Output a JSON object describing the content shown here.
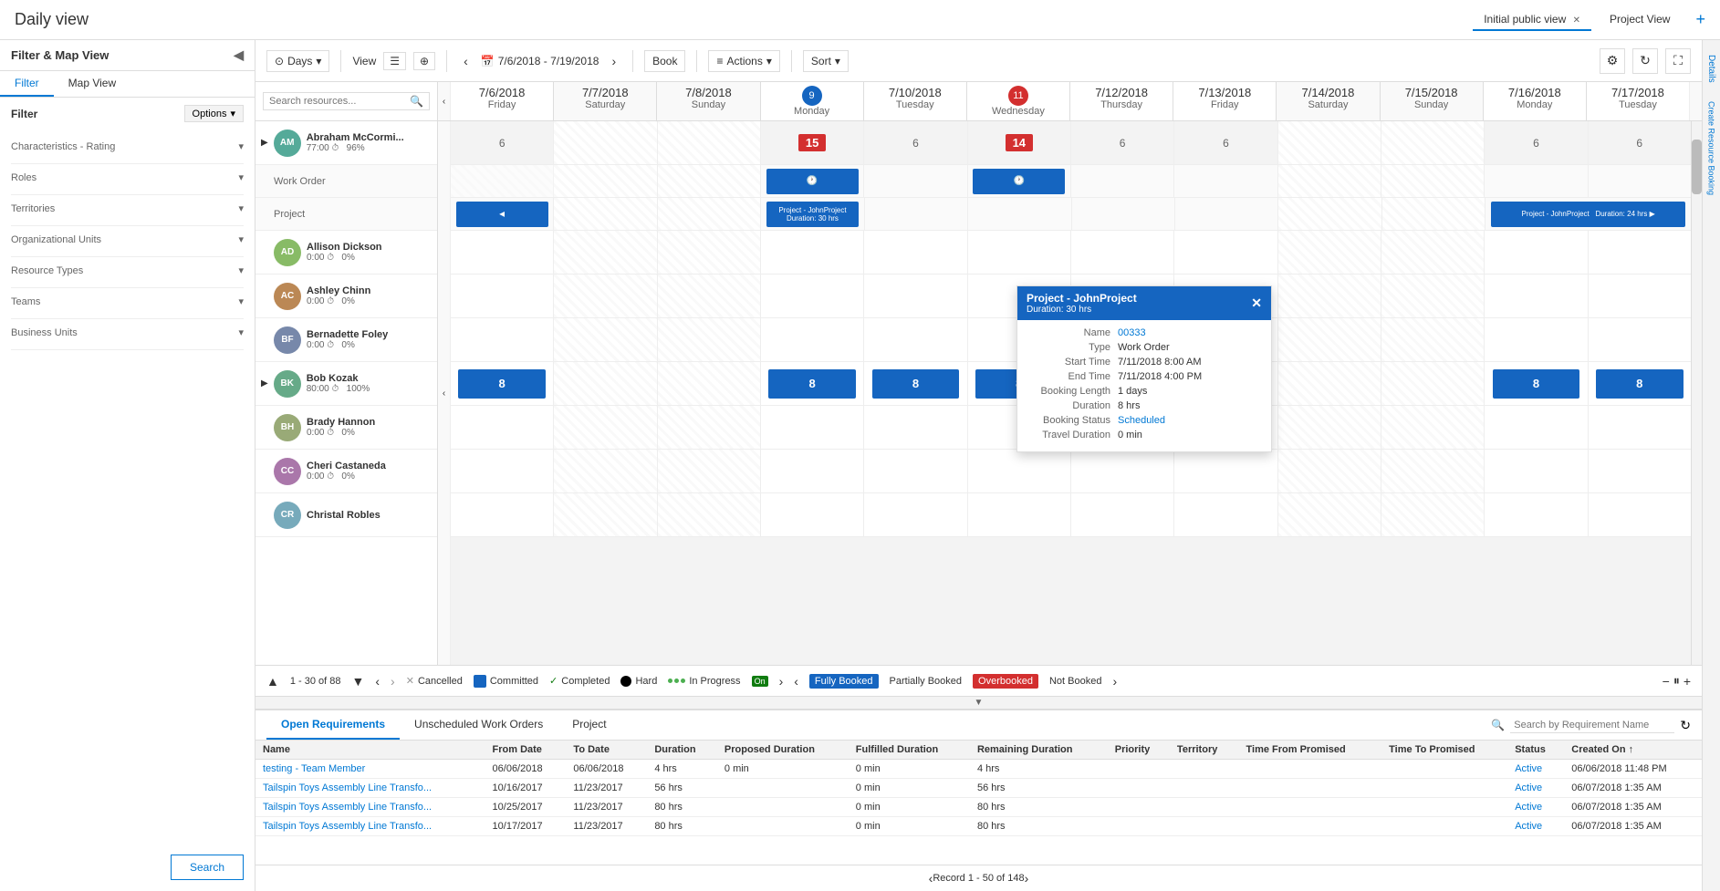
{
  "app": {
    "title": "Daily view",
    "tabs": [
      {
        "label": "Initial public view",
        "active": true
      },
      {
        "label": "Project View",
        "active": false
      }
    ],
    "tab_add": "+"
  },
  "left_panel": {
    "title": "Filter & Map View",
    "collapse_icon": "◀",
    "tabs": [
      "Filter",
      "Map View"
    ],
    "active_tab": "Filter",
    "filter_label": "Filter",
    "options_btn": "Options",
    "filter_groups": [
      {
        "label": "Characteristics - Rating"
      },
      {
        "label": "Roles"
      },
      {
        "label": "Territories"
      },
      {
        "label": "Organizational Units"
      },
      {
        "label": "Resource Types"
      },
      {
        "label": "Teams"
      },
      {
        "label": "Business Units"
      }
    ],
    "search_btn": "Search"
  },
  "toolbar": {
    "days_label": "Days",
    "view_label": "View",
    "date_range": "7/6/2018 - 7/19/2018",
    "book_label": "Book",
    "actions_label": "Actions",
    "sort_label": "Sort"
  },
  "date_columns": [
    {
      "date": "7/6/2018",
      "day": "Friday",
      "weekend": false
    },
    {
      "date": "7/7/2018",
      "day": "Saturday",
      "weekend": true
    },
    {
      "date": "7/8/2018",
      "day": "Sunday",
      "weekend": true
    },
    {
      "date": "7/9/2018",
      "day": "Monday",
      "weekend": false,
      "highlight": true
    },
    {
      "date": "7/10/2018",
      "day": "Tuesday",
      "weekend": false
    },
    {
      "date": "7/11/2018",
      "day": "Wednesday",
      "weekend": false,
      "highlight_red": true
    },
    {
      "date": "7/12/2018",
      "day": "Thursday",
      "weekend": false
    },
    {
      "date": "7/13/2018",
      "day": "Friday",
      "weekend": false
    },
    {
      "date": "7/14/2018",
      "day": "Saturday",
      "weekend": true
    },
    {
      "date": "7/15/2018",
      "day": "Sunday",
      "weekend": true
    },
    {
      "date": "7/16/2018",
      "day": "Monday",
      "weekend": false
    },
    {
      "date": "7/17/2018",
      "day": "Tuesday",
      "weekend": false
    }
  ],
  "resources": [
    {
      "name": "Abraham McCormi...",
      "hours": "77:00",
      "utilization": "96%",
      "avatar_initials": "AM",
      "avatar_color": "#5a9",
      "sub_rows": [
        "Work Order",
        "Project"
      ],
      "bookings": {
        "col3": {
          "type": "hours",
          "value": "15",
          "color": "#d32f2f",
          "span": 1
        },
        "col5": {
          "type": "hours",
          "value": "6",
          "color": "none",
          "span": 1
        },
        "col5_red": {
          "type": "hours",
          "value": "14",
          "color": "#d32f2f",
          "span": 1
        },
        "col7": {
          "type": "hours",
          "value": "6",
          "color": "none"
        },
        "col8": {
          "type": "hours",
          "value": "6",
          "color": "none"
        },
        "col10": {
          "type": "hours",
          "value": "6",
          "color": "none"
        },
        "col11": {
          "type": "hours",
          "value": "6",
          "color": "none"
        }
      }
    },
    {
      "name": "Allison Dickson",
      "hours": "0:00",
      "utilization": "0%",
      "avatar_initials": "AD",
      "avatar_color": "#8b6",
      "sub_rows": []
    },
    {
      "name": "Ashley Chinn",
      "hours": "0:00",
      "utilization": "0%",
      "avatar_initials": "AC",
      "avatar_color": "#b85",
      "sub_rows": []
    },
    {
      "name": "Bernadette Foley",
      "hours": "0:00",
      "utilization": "0%",
      "avatar_initials": "BF",
      "avatar_color": "#78a",
      "sub_rows": []
    },
    {
      "name": "Bob Kozak",
      "hours": "80:00",
      "utilization": "100%",
      "avatar_initials": "BK",
      "avatar_color": "#6a8",
      "sub_rows": [],
      "bookings_all": "8"
    },
    {
      "name": "Brady Hannon",
      "hours": "0:00",
      "utilization": "0%",
      "avatar_initials": "BH",
      "avatar_color": "#9a7",
      "sub_rows": []
    },
    {
      "name": "Cheri Castaneda",
      "hours": "0:00",
      "utilization": "0%",
      "avatar_initials": "CC",
      "avatar_color": "#a7a",
      "sub_rows": []
    },
    {
      "name": "Christal Robles",
      "hours": "",
      "utilization": "",
      "avatar_initials": "CR",
      "avatar_color": "#7ab",
      "sub_rows": []
    }
  ],
  "popup": {
    "title": "Project - JohnProject",
    "title2": "Duration: 30 hrs",
    "name_label": "Name",
    "name_value": "00333",
    "name_link": true,
    "type_label": "Type",
    "type_value": "Work Order",
    "start_time_label": "Start Time",
    "start_time_value": "7/11/2018 8:00 AM",
    "end_time_label": "End Time",
    "end_time_value": "7/11/2018 4:00 PM",
    "booking_length_label": "Booking Length",
    "booking_length_value": "1 days",
    "duration_label": "Duration",
    "duration_value": "8 hrs",
    "booking_status_label": "Booking Status",
    "booking_status_value": "Scheduled",
    "booking_status_link": true,
    "travel_label": "Travel Duration",
    "travel_value": "0 min"
  },
  "bottom_bar": {
    "pagination": "1 - 30 of 88",
    "legend": {
      "cancelled": "Cancelled",
      "committed": "Committed",
      "completed": "Completed",
      "hard": "Hard",
      "in_progress": "In Progress",
      "on": "On",
      "fully_booked": "Fully Booked",
      "partially_booked": "Partially Booked",
      "overbooked": "Overbooked",
      "not_booked": "Not Booked"
    }
  },
  "requirements": {
    "tabs": [
      "Open Requirements",
      "Unscheduled Work Orders",
      "Project"
    ],
    "active_tab": "Open Requirements",
    "search_placeholder": "Search by Requirement Name",
    "columns": [
      "Name",
      "From Date",
      "To Date",
      "Duration",
      "Proposed Duration",
      "Fulfilled Duration",
      "Remaining Duration",
      "Priority",
      "Territory",
      "Time From Promised",
      "Time To Promised",
      "Status",
      "Created On"
    ],
    "rows": [
      {
        "name": "testing - Team Member",
        "from_date": "06/06/2018",
        "to_date": "06/06/2018",
        "duration": "4 hrs",
        "proposed_duration": "0 min",
        "fulfilled_duration": "0 min",
        "remaining_duration": "4 hrs",
        "priority": "",
        "territory": "",
        "time_from_promised": "",
        "time_to_promised": "",
        "status": "Active",
        "created_on": "06/06/2018 11:48 PM"
      },
      {
        "name": "Tailspin Toys Assembly Line Transfo...",
        "from_date": "10/16/2017",
        "to_date": "11/23/2017",
        "duration": "56 hrs",
        "proposed_duration": "",
        "fulfilled_duration": "0 min",
        "remaining_duration": "56 hrs",
        "priority": "",
        "territory": "",
        "time_from_promised": "",
        "time_to_promised": "",
        "status": "Active",
        "created_on": "06/07/2018 1:35 AM"
      },
      {
        "name": "Tailspin Toys Assembly Line Transfo...",
        "from_date": "10/25/2017",
        "to_date": "11/23/2017",
        "duration": "80 hrs",
        "proposed_duration": "",
        "fulfilled_duration": "0 min",
        "remaining_duration": "80 hrs",
        "priority": "",
        "territory": "",
        "time_from_promised": "",
        "time_to_promised": "",
        "status": "Active",
        "created_on": "06/07/2018 1:35 AM"
      },
      {
        "name": "Tailspin Toys Assembly Line Transfo...",
        "from_date": "10/17/2017",
        "to_date": "11/23/2017",
        "duration": "80 hrs",
        "proposed_duration": "",
        "fulfilled_duration": "0 min",
        "remaining_duration": "80 hrs",
        "priority": "",
        "territory": "",
        "time_from_promised": "",
        "time_to_promised": "",
        "status": "Active",
        "created_on": "06/07/2018 1:35 AM"
      }
    ],
    "footer": "Record 1 - 50 of 148"
  },
  "details_sidebar": {
    "label": "Details",
    "create_booking": "Create Resource Booking"
  }
}
